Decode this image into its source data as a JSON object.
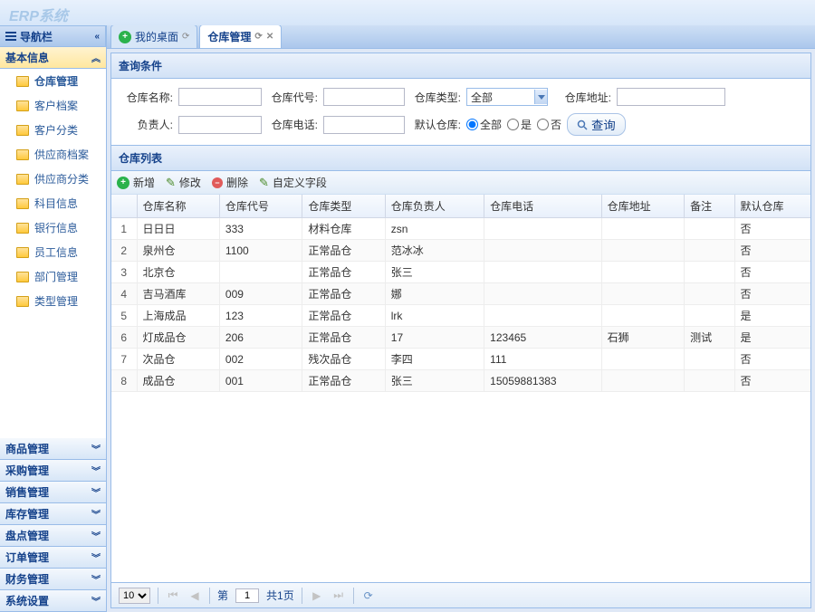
{
  "logo": "ERP系统",
  "sidebar": {
    "title": "导航栏",
    "groups": [
      {
        "label": "基本信息",
        "expanded": true,
        "items": [
          {
            "label": "仓库管理",
            "active": true
          },
          {
            "label": "客户档案"
          },
          {
            "label": "客户分类"
          },
          {
            "label": "供应商档案"
          },
          {
            "label": "供应商分类"
          },
          {
            "label": "科目信息"
          },
          {
            "label": "银行信息"
          },
          {
            "label": "员工信息"
          },
          {
            "label": "部门管理"
          },
          {
            "label": "类型管理"
          }
        ]
      },
      {
        "label": "商品管理"
      },
      {
        "label": "采购管理"
      },
      {
        "label": "销售管理"
      },
      {
        "label": "库存管理"
      },
      {
        "label": "盘点管理"
      },
      {
        "label": "订单管理"
      },
      {
        "label": "财务管理"
      },
      {
        "label": "系统设置"
      }
    ]
  },
  "tabs": [
    {
      "label": "我的桌面",
      "active": false
    },
    {
      "label": "仓库管理",
      "active": true
    }
  ],
  "search": {
    "title": "查询条件",
    "fields": {
      "name": {
        "label": "仓库名称:",
        "value": ""
      },
      "code": {
        "label": "仓库代号:",
        "value": ""
      },
      "type": {
        "label": "仓库类型:",
        "value": "全部"
      },
      "addr": {
        "label": "仓库地址:",
        "value": ""
      },
      "owner": {
        "label": "负责人:",
        "value": ""
      },
      "phone": {
        "label": "仓库电话:",
        "value": ""
      },
      "default": {
        "label": "默认仓库:",
        "options": [
          "全部",
          "是",
          "否"
        ],
        "selected": "全部"
      }
    },
    "button": "查询"
  },
  "list": {
    "title": "仓库列表",
    "toolbar": {
      "add": "新增",
      "edit": "修改",
      "del": "删除",
      "custom": "自定义字段"
    },
    "columns": [
      "仓库名称",
      "仓库代号",
      "仓库类型",
      "仓库负责人",
      "仓库电话",
      "仓库地址",
      "备注",
      "默认仓库"
    ],
    "rows": [
      {
        "n": 1,
        "name": "日日日",
        "code": "333",
        "type": "材料仓库",
        "owner": "zsn",
        "phone": "",
        "addr": "",
        "remark": "",
        "def": "否"
      },
      {
        "n": 2,
        "name": "泉州仓",
        "code": "1100",
        "type": "正常品仓",
        "owner": "范冰冰",
        "phone": "",
        "addr": "",
        "remark": "",
        "def": "否"
      },
      {
        "n": 3,
        "name": "北京仓",
        "code": "",
        "type": "正常品仓",
        "owner": "张三",
        "phone": "",
        "addr": "",
        "remark": "",
        "def": "否"
      },
      {
        "n": 4,
        "name": "吉马酒库",
        "code": "009",
        "type": "正常品仓",
        "owner": "娜",
        "phone": "",
        "addr": "",
        "remark": "",
        "def": "否"
      },
      {
        "n": 5,
        "name": "上海成品",
        "code": "123",
        "type": "正常品仓",
        "owner": "lrk",
        "phone": "",
        "addr": "",
        "remark": "",
        "def": "是"
      },
      {
        "n": 6,
        "name": "灯成品仓",
        "code": "206",
        "type": "正常品仓",
        "owner": "17",
        "phone": "123465",
        "addr": "石狮",
        "remark": "测试",
        "def": "是"
      },
      {
        "n": 7,
        "name": "次品仓",
        "code": "002",
        "type": "残次品仓",
        "owner": "李四",
        "phone": "111",
        "addr": "",
        "remark": "",
        "def": "否"
      },
      {
        "n": 8,
        "name": "成品仓",
        "code": "001",
        "type": "正常品仓",
        "owner": "张三",
        "phone": "15059881383",
        "addr": "",
        "remark": "",
        "def": "否"
      }
    ]
  },
  "pager": {
    "size": "10",
    "page": "1",
    "totalPages": "共1页",
    "pageLabel": "第"
  }
}
